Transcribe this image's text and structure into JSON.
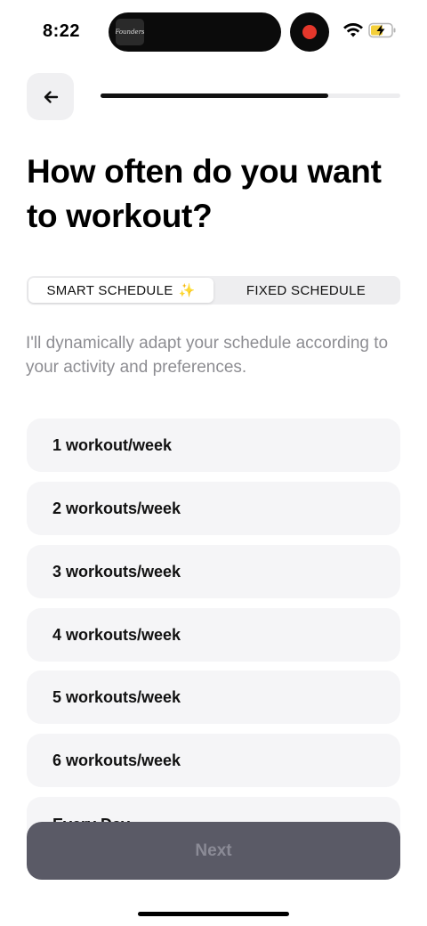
{
  "status_bar": {
    "time": "8:22",
    "island_thumb_text": "Founders",
    "recording_color": "#e5372b",
    "wifi_icon": "wifi-icon",
    "battery_icon": "battery-charging-icon"
  },
  "header": {
    "back_icon": "arrow-left-icon",
    "progress_fraction": 0.76
  },
  "title": "How often do you want to workout?",
  "schedule_tabs": [
    {
      "label": "SMART SCHEDULE",
      "suffix": "✨",
      "selected": true
    },
    {
      "label": "FIXED SCHEDULE",
      "suffix": "",
      "selected": false
    }
  ],
  "description": "I'll dynamically adapt your schedule according to your activity and preferences.",
  "options": [
    "1 workout/week",
    "2 workouts/week",
    "3 workouts/week",
    "4 workouts/week",
    "5 workouts/week",
    "6 workouts/week",
    "Every Day"
  ],
  "next_button": {
    "label": "Next",
    "color": "#5a5a66"
  }
}
